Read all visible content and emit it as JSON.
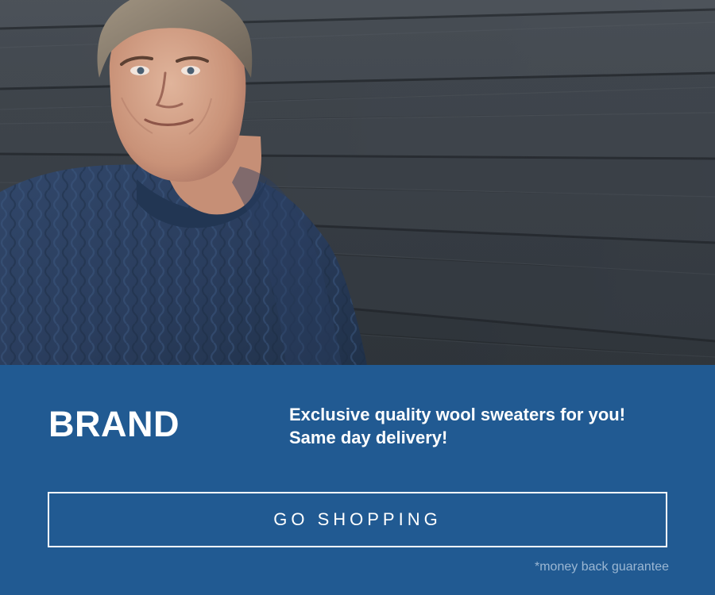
{
  "brand": {
    "logo_text": "BRAND"
  },
  "hero": {
    "image": "man-in-navy-cable-knit-sweater-against-dark-wooden-wall"
  },
  "promo": {
    "line_1": "Exclusive quality wool sweaters for you!",
    "line_2": "Same day delivery!"
  },
  "cta": {
    "label": "GO SHOPPING"
  },
  "footer": {
    "guarantee": "*money back guarantee"
  },
  "colors": {
    "panel_background": "#215a92",
    "text_primary": "#ffffff",
    "text_muted": "#9bb7d3",
    "button_border": "#ffffff"
  }
}
